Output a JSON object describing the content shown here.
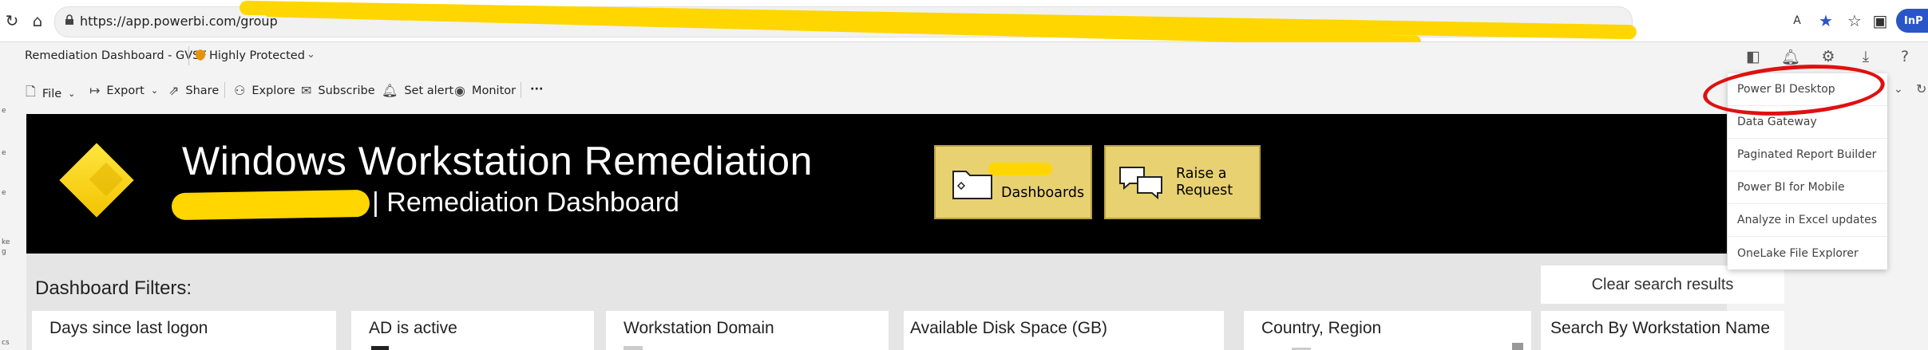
{
  "browser": {
    "back_icon": "refresh-icon",
    "url": "https://app.powerbi.com/group",
    "profile_label": "InP"
  },
  "header": {
    "report_title": "Remediation Dashboard - GVSF",
    "sensitivity_label": "Highly Protected"
  },
  "toolbar": {
    "file": "File",
    "export": "Export",
    "share": "Share",
    "explore": "Explore",
    "subscribe": "Subscribe",
    "set_alert": "Set alert",
    "monitor": "Monitor",
    "more": "···"
  },
  "download_menu": {
    "items": [
      "Power BI Desktop",
      "Data Gateway",
      "Paginated Report Builder",
      "Power BI for Mobile",
      "Analyze in Excel updates",
      "OneLake File Explorer"
    ]
  },
  "banner": {
    "title": "Windows Workstation Remediation",
    "subtitle": "| Remediation Dashboard",
    "dashboards_label": "Dashboards",
    "raise_request_line1": "Raise a",
    "raise_request_line2": "Request"
  },
  "filters": {
    "heading": "Dashboard Filters:",
    "clear_label": "Clear search results",
    "cards": [
      "Days since last logon",
      "AD is active",
      "Workstation Domain",
      "Available Disk Space (GB)",
      "Country, Region",
      "Search By Workstation Name"
    ]
  },
  "colors": {
    "banner_bg": "#000000",
    "tile_bg": "#e8d171",
    "highlight_circle": "#e01010",
    "redaction": "#ffd600"
  }
}
